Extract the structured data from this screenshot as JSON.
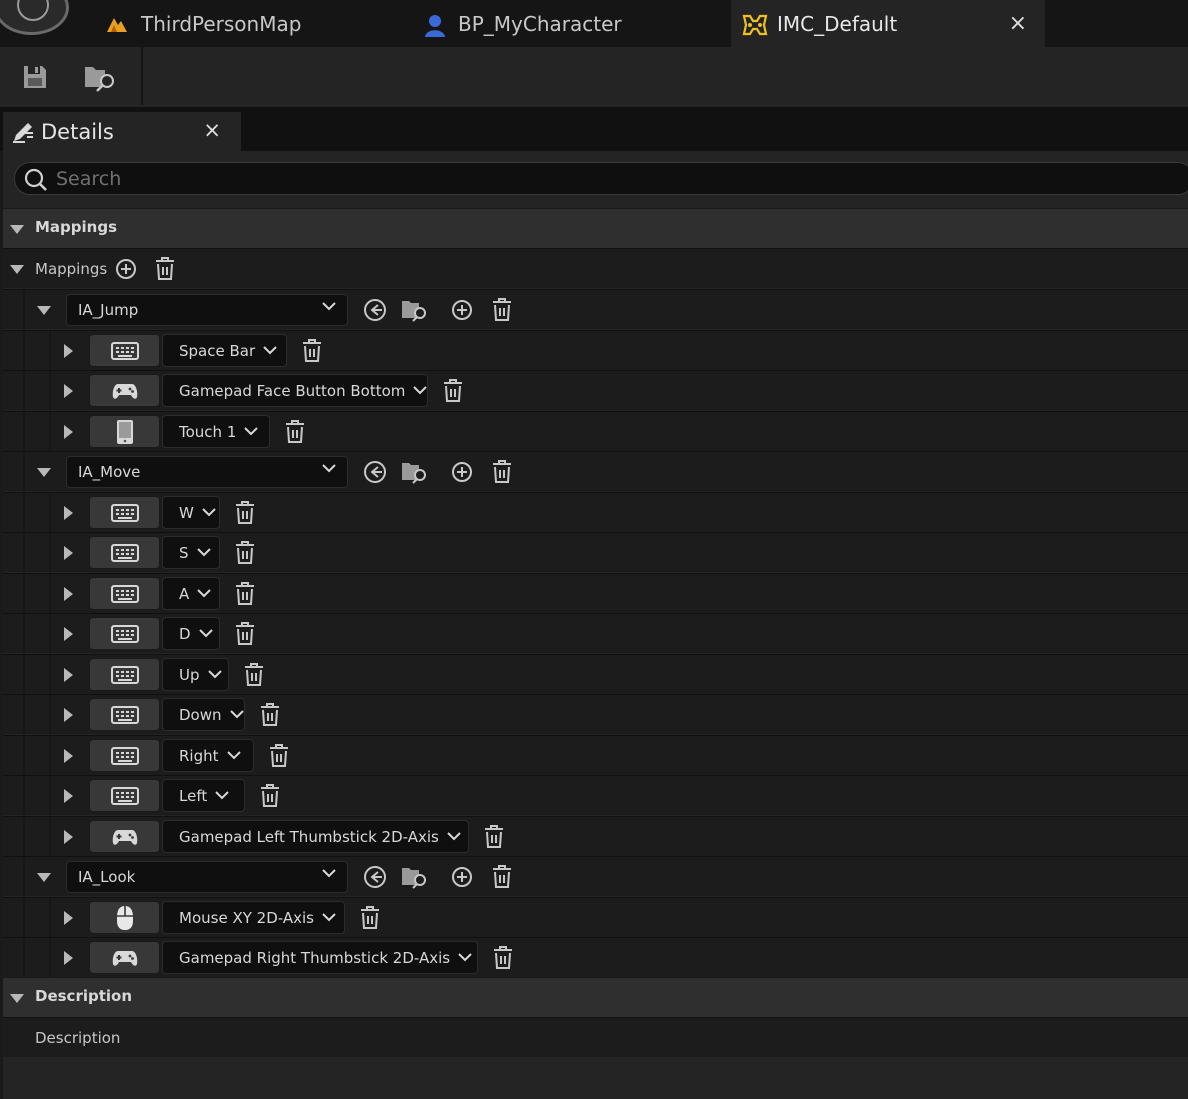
{
  "tabs": [
    {
      "label": "ThirdPersonMap",
      "icon": "level-map-icon"
    },
    {
      "label": "BP_MyCharacter",
      "icon": "character-blueprint-icon"
    },
    {
      "label": "IMC_Default",
      "icon": "input-mapping-context-icon",
      "active": true
    }
  ],
  "tab_close": "×",
  "toolbar": {
    "save_icon": "save-icon",
    "browse_icon": "browse-to-asset-icon"
  },
  "details": {
    "title": "Details",
    "close": "×"
  },
  "search": {
    "placeholder": "Search",
    "value": ""
  },
  "sections": {
    "mappings_category": "Mappings",
    "mappings_array": "Mappings",
    "description_category": "Description",
    "description_prop": "Description"
  },
  "actions": [
    {
      "name": "IA_Jump",
      "keys": [
        {
          "device": "keyboard",
          "key": "Space Bar"
        },
        {
          "device": "gamepad",
          "key": "Gamepad Face Button Bottom"
        },
        {
          "device": "touch",
          "key": "Touch 1"
        }
      ]
    },
    {
      "name": "IA_Move",
      "keys": [
        {
          "device": "keyboard",
          "key": "W"
        },
        {
          "device": "keyboard",
          "key": "S"
        },
        {
          "device": "keyboard",
          "key": "A"
        },
        {
          "device": "keyboard",
          "key": "D"
        },
        {
          "device": "keyboard",
          "key": "Up"
        },
        {
          "device": "keyboard",
          "key": "Down"
        },
        {
          "device": "keyboard",
          "key": "Right"
        },
        {
          "device": "keyboard",
          "key": "Left"
        },
        {
          "device": "gamepad",
          "key": "Gamepad Left Thumbstick 2D-Axis"
        }
      ]
    },
    {
      "name": "IA_Look",
      "keys": [
        {
          "device": "mouse",
          "key": "Mouse XY 2D-Axis"
        },
        {
          "device": "gamepad",
          "key": "Gamepad Right Thumbstick 2D-Axis"
        }
      ]
    }
  ],
  "colors": {
    "accent": "#f0c020",
    "panel": "#242424",
    "field": "#0f0f0f"
  }
}
